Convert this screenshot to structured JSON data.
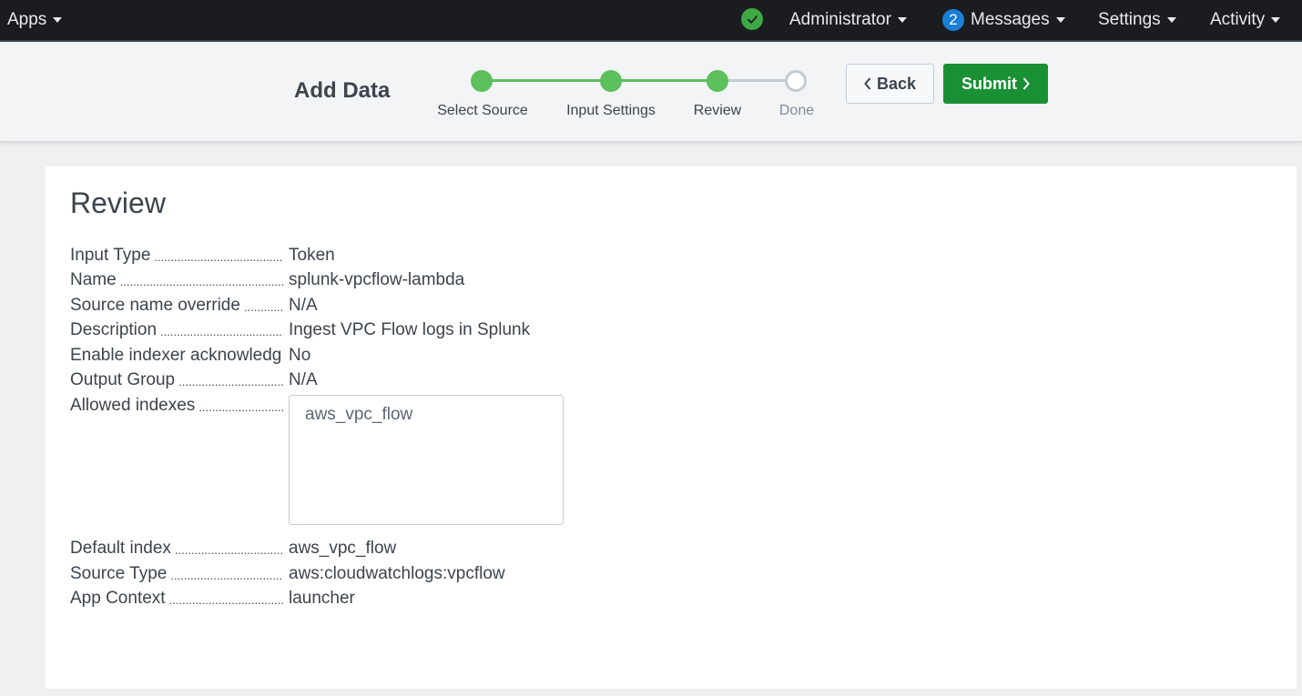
{
  "topnav": {
    "apps_label": "Apps",
    "health_icon": "check-circle-icon",
    "health_color": "#3ea844",
    "user_label": "Administrator",
    "messages_count": "2",
    "messages_label": "Messages",
    "settings_label": "Settings",
    "activity_label": "Activity"
  },
  "wizard": {
    "title": "Add Data",
    "steps": [
      {
        "label": "Select Source",
        "status": "done"
      },
      {
        "label": "Input Settings",
        "status": "done"
      },
      {
        "label": "Review",
        "status": "done"
      },
      {
        "label": "Done",
        "status": "todo"
      }
    ],
    "back_label": "Back",
    "submit_label": "Submit",
    "accent_color": "#5cc05c",
    "submit_color": "#1a9035"
  },
  "review": {
    "title": "Review",
    "fields": {
      "input_type": {
        "label": "Input Type",
        "value": "Token"
      },
      "name": {
        "label": "Name",
        "value": "splunk-vpcflow-lambda"
      },
      "source_name": {
        "label": "Source name override",
        "value": "N/A"
      },
      "description": {
        "label": "Description",
        "value": "Ingest VPC Flow logs in Splunk"
      },
      "indexer_ack": {
        "label": "Enable indexer acknowledg",
        "value": "No"
      },
      "output_group": {
        "label": "Output Group",
        "value": "N/A"
      },
      "allowed": {
        "label": "Allowed indexes",
        "value": "aws_vpc_flow"
      },
      "default_index": {
        "label": "Default index",
        "value": "aws_vpc_flow"
      },
      "source_type": {
        "label": "Source Type",
        "value": "aws:cloudwatchlogs:vpcflow"
      },
      "app_context": {
        "label": "App Context",
        "value": "launcher"
      }
    }
  }
}
